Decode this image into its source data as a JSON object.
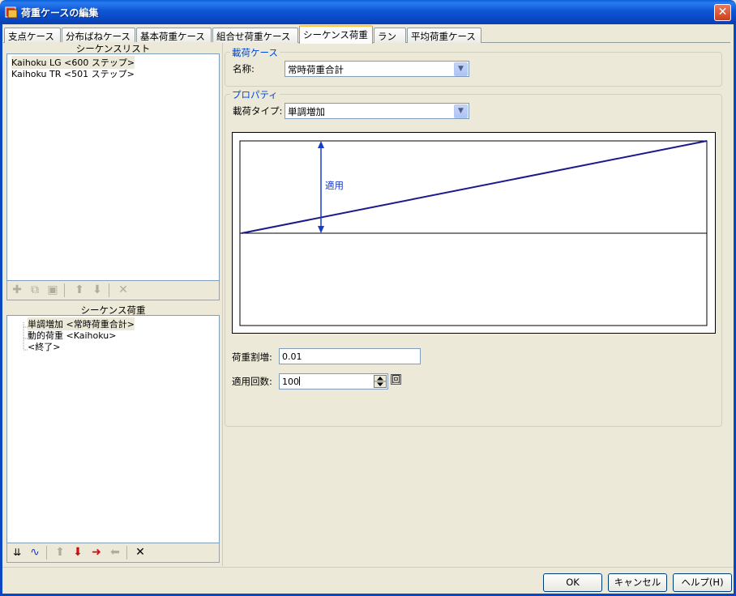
{
  "window": {
    "title": "荷重ケースの編集",
    "close_label": "✕"
  },
  "tabs": [
    {
      "label": "支点ケース"
    },
    {
      "label": "分布ばねケース"
    },
    {
      "label": "基本荷重ケース"
    },
    {
      "label": "組合せ荷重ケース"
    },
    {
      "label": "シーケンス荷重"
    },
    {
      "label": "ラン"
    },
    {
      "label": "平均荷重ケース"
    }
  ],
  "sequence_list": {
    "header": "シーケンスリスト",
    "items": [
      {
        "label": "Kaihoku LG <600 ステップ>"
      },
      {
        "label": "Kaihoku TR <501 ステップ>"
      }
    ]
  },
  "sequence_load": {
    "header": "シーケンス荷重",
    "items": [
      {
        "label": "単調増加 <常時荷重合計>"
      },
      {
        "label": "動的荷重 <Kaihoku>"
      },
      {
        "label": "<終了>"
      }
    ]
  },
  "load_case_group": {
    "title": "載荷ケース",
    "name_label": "名称:",
    "name_value": "常時荷重合計"
  },
  "properties_group": {
    "title": "プロパティ",
    "type_label": "載荷タイプ:",
    "type_value": "単調増加",
    "diagram_label": "適用",
    "increment_label": "荷重割増:",
    "increment_value": "0.01",
    "count_label": "適用回数:",
    "count_value": "100",
    "count_unit": "回"
  },
  "buttons": {
    "ok": "OK",
    "cancel": "キャンセル",
    "help": "ヘルプ(H)"
  }
}
